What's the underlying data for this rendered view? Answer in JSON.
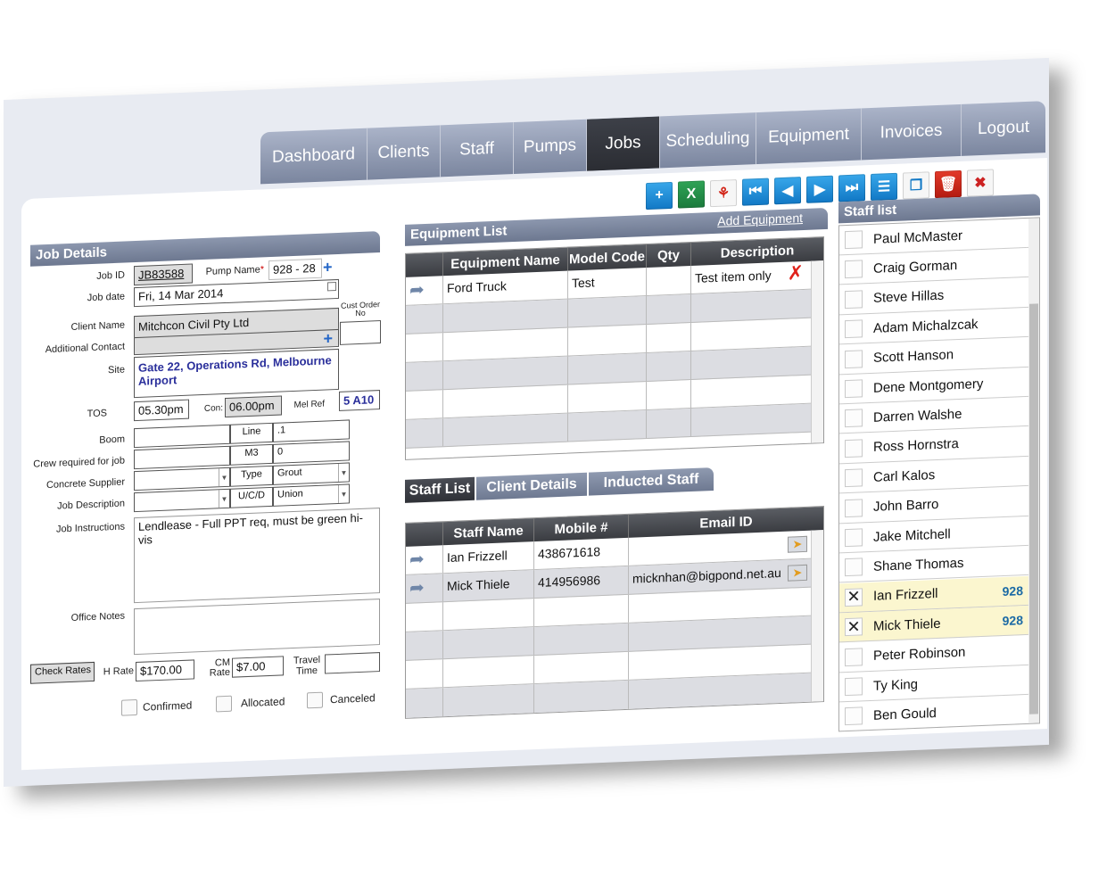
{
  "nav": {
    "tabs": [
      "Dashboard",
      "Clients",
      "Staff",
      "Pumps",
      "Jobs",
      "Scheduling",
      "Equipment",
      "Invoices",
      "Logout"
    ],
    "active": "Jobs"
  },
  "toolbar": {
    "icons": [
      "add-icon",
      "excel-icon",
      "pdf-icon",
      "first-record-icon",
      "previous-record-icon",
      "next-record-icon",
      "last-record-icon",
      "list-view-icon",
      "duplicate-icon",
      "delete-icon",
      "settings-icon"
    ]
  },
  "job": {
    "header": "Job Details",
    "job_id_label": "Job ID",
    "job_id": "JB83588",
    "pump_name_label": "Pump Name",
    "pump_name": "928 - 28",
    "job_date_label": "Job date",
    "job_date": "Fri, 14 Mar 2014",
    "client_name_label": "Client Name",
    "client_name": "Mitchcon Civil Pty Ltd",
    "cust_order_label": "Cust Order No",
    "additional_contact_label": "Additional Contact",
    "site_label": "Site",
    "site": "Gate 22, Operations Rd, Melbourne Airport",
    "tos_label": "TOS",
    "tos": "05.30pm",
    "con_label": "Con:",
    "con": "06.00pm",
    "mel_ref_label": "Mel Ref",
    "mel_ref": "5 A10",
    "boom_label": "Boom",
    "line_label": "Line",
    "line": ".1",
    "crew_label": "Crew required for job",
    "m3_label": "M3",
    "m3": "0",
    "supplier_label": "Concrete Supplier",
    "type_label": "Type",
    "type": "Grout",
    "desc_label": "Job Description",
    "ucd_label": "U/C/D",
    "ucd": "Union",
    "instructions_label": "Job Instructions",
    "instructions": "Lendlease - Full PPT req, must be green hi-vis",
    "office_notes_label": "Office Notes",
    "check_rates": "Check Rates",
    "h_rate_label": "H Rate",
    "h_rate": "$170.00",
    "cm_rate_label": "CM Rate",
    "cm_rate": "$7.00",
    "travel_label": "Travel Time",
    "confirmed": "Confirmed",
    "allocated": "Allocated",
    "canceled": "Canceled"
  },
  "equipment": {
    "header": "Equipment List",
    "add_link": "Add Equipment",
    "columns": [
      "Equipment Name",
      "Model Code",
      "Qty",
      "Description"
    ],
    "rows": [
      {
        "name": "Ford Truck",
        "model": "Test",
        "qty": "",
        "desc": "Test item only"
      }
    ]
  },
  "subtabs": [
    "Staff List",
    "Client Details",
    "Inducted Staff"
  ],
  "staff_grid": {
    "columns": [
      "Staff Name",
      "Mobile #",
      "Email ID"
    ],
    "rows": [
      {
        "name": "Ian Frizzell",
        "mobile": "438671618",
        "email": ""
      },
      {
        "name": "Mick Thiele",
        "mobile": "414956986",
        "email": "micknhan@bigpond.net.au"
      }
    ]
  },
  "staff_list": {
    "header": "Staff list",
    "items": [
      {
        "name": "Paul McMaster",
        "checked": false,
        "num": ""
      },
      {
        "name": "Craig Gorman",
        "checked": false,
        "num": ""
      },
      {
        "name": "Steve Hillas",
        "checked": false,
        "num": ""
      },
      {
        "name": "Adam Michalzcak",
        "checked": false,
        "num": ""
      },
      {
        "name": "Scott Hanson",
        "checked": false,
        "num": ""
      },
      {
        "name": "Dene Montgomery",
        "checked": false,
        "num": ""
      },
      {
        "name": "Darren Walshe",
        "checked": false,
        "num": ""
      },
      {
        "name": "Ross Hornstra",
        "checked": false,
        "num": ""
      },
      {
        "name": "Carl Kalos",
        "checked": false,
        "num": ""
      },
      {
        "name": "John Barro",
        "checked": false,
        "num": ""
      },
      {
        "name": "Jake Mitchell",
        "checked": false,
        "num": ""
      },
      {
        "name": "Shane Thomas",
        "checked": false,
        "num": ""
      },
      {
        "name": "Ian Frizzell",
        "checked": true,
        "num": "928"
      },
      {
        "name": "Mick Thiele",
        "checked": true,
        "num": "928"
      },
      {
        "name": "Peter Robinson",
        "checked": false,
        "num": ""
      },
      {
        "name": "Ty King",
        "checked": false,
        "num": ""
      },
      {
        "name": "Ben Gould",
        "checked": false,
        "num": ""
      }
    ]
  }
}
